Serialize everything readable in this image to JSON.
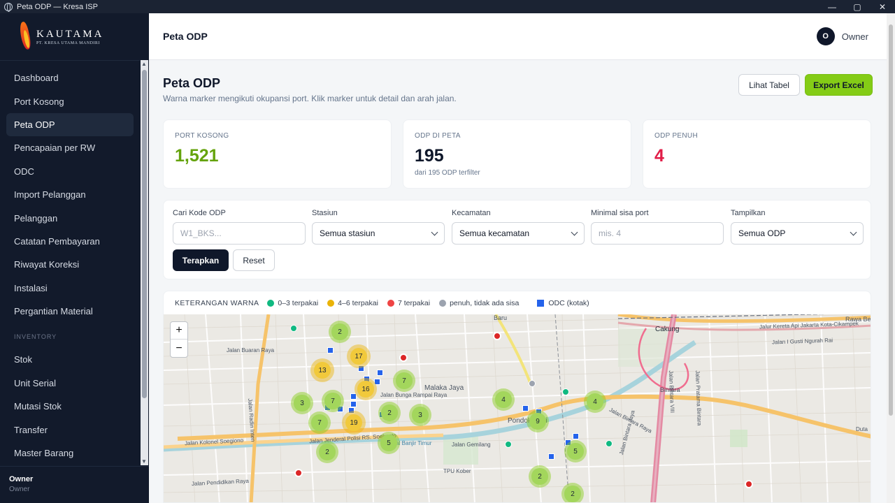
{
  "window": {
    "title": "Peta ODP — Kresa ISP",
    "minimize": "—",
    "maximize": "▢",
    "close": "✕"
  },
  "brand": {
    "name": "KAUTAMA",
    "tagline": "PT. KRESA UTAMA MANDIRI"
  },
  "sidebar": {
    "items": [
      {
        "label": "Dashboard"
      },
      {
        "label": "Port Kosong"
      },
      {
        "label": "Peta ODP",
        "active": true
      },
      {
        "label": "Pencapaian per RW"
      },
      {
        "label": "ODC"
      },
      {
        "label": "Import Pelanggan"
      },
      {
        "label": "Pelanggan"
      },
      {
        "label": "Catatan Pembayaran"
      },
      {
        "label": "Riwayat Koreksi"
      },
      {
        "label": "Instalasi"
      },
      {
        "label": "Pergantian Material"
      }
    ],
    "section_inventory": "INVENTORY",
    "inventory_items": [
      {
        "label": "Stok"
      },
      {
        "label": "Unit Serial"
      },
      {
        "label": "Mutasi Stok"
      },
      {
        "label": "Transfer"
      },
      {
        "label": "Master Barang"
      }
    ],
    "user": {
      "name": "Owner",
      "role": "Owner"
    }
  },
  "header": {
    "title": "Peta ODP",
    "user_initial": "O",
    "user_name": "Owner"
  },
  "page": {
    "title": "Peta ODP",
    "subtitle": "Warna marker mengikuti okupansi port. Klik marker untuk detail dan arah jalan.",
    "btn_table": "Lihat Tabel",
    "btn_export": "Export Excel"
  },
  "stats": {
    "port_kosong": {
      "label": "PORT KOSONG",
      "value": "1,521",
      "color": "#65a30d"
    },
    "odp_di_peta": {
      "label": "ODP DI PETA",
      "value": "195",
      "note": "dari 195 ODP terfilter",
      "color": "#0f172a"
    },
    "odp_penuh": {
      "label": "ODP PENUH",
      "value": "4",
      "color": "#e11d48"
    }
  },
  "filters": {
    "kode": {
      "label": "Cari Kode ODP",
      "placeholder": "W1_BKS..."
    },
    "stasiun": {
      "label": "Stasiun",
      "value": "Semua stasiun"
    },
    "kecamatan": {
      "label": "Kecamatan",
      "value": "Semua kecamatan"
    },
    "minport": {
      "label": "Minimal sisa port",
      "placeholder": "mis. 4"
    },
    "tampilkan": {
      "label": "Tampilkan",
      "value": "Semua ODP"
    },
    "apply": "Terapkan",
    "reset": "Reset"
  },
  "legend": {
    "title": "KETERANGAN WARNA",
    "items": [
      {
        "label": "0–3 terpakai",
        "color": "#10b981"
      },
      {
        "label": "4–6 terpakai",
        "color": "#eab308"
      },
      {
        "label": "7 terpakai",
        "color": "#ef4444"
      },
      {
        "label": "penuh, tidak ada sisa",
        "color": "#9ca3af"
      },
      {
        "label": "ODC (kotak)",
        "color": "#2563eb"
      }
    ]
  },
  "map": {
    "zoom_in": "+",
    "zoom_out": "−",
    "clusters": [
      "2",
      "17",
      "13",
      "16",
      "7",
      "3",
      "7",
      "2",
      "3",
      "19",
      "7",
      "5",
      "2",
      "4",
      "9",
      "4",
      "5",
      "2",
      "2"
    ],
    "labels": {
      "l1": "Jalan Buaran Raya",
      "l2": "Jalan Radin Inten",
      "l3": "Malaka Jaya",
      "l4": "Jalan Bunga Rampai Raya",
      "l5": "Jalan Kolonel Soegiono",
      "l6": "Jalan Jenderal Polisi RS. Soekanto",
      "l7": "Pondok Kopi",
      "l8": "Jalan Bintara Raya",
      "l9": "Bintara",
      "l10": "Cakung",
      "l11": "Jalan I Gusti Ngurah Rai",
      "l12": "Jalur Kereta Api Jakarta Kota-Cikampek",
      "l13": "TPU Kober",
      "l14": "Jalan Pendidikan Raya",
      "l15": "Baru",
      "l16": "Rawa Bebek",
      "l17": "Jalan Gemilang",
      "l18": "Kanal Banjir Timur",
      "l19": "Jalan Bintara Jaya",
      "l20": "Jalan Bintara VIII",
      "l21": "Jalan Pratama Bintara",
      "l22": "Duta"
    }
  }
}
